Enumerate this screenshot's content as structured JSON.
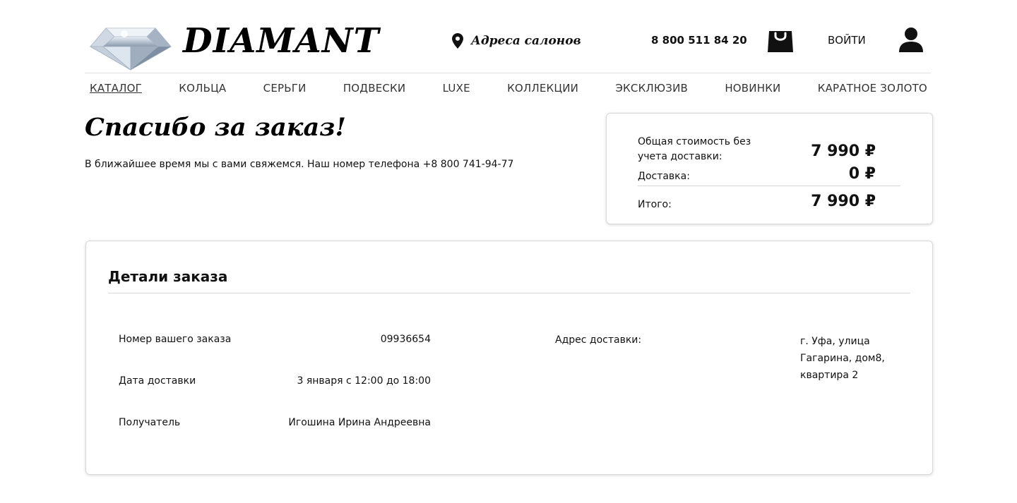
{
  "header": {
    "brand": "DIAMANT",
    "addresses_label": "Адреса салонов",
    "phone": "8 800 511 84 20",
    "login_label": "ВОЙТИ"
  },
  "nav": {
    "items": [
      {
        "label": "КАТАЛОГ",
        "active": true
      },
      {
        "label": "КОЛЬЦА"
      },
      {
        "label": "СЕРЬГИ"
      },
      {
        "label": "ПОДВЕСКИ"
      },
      {
        "label": "LUXE"
      },
      {
        "label": "КОЛЛЕКЦИИ"
      },
      {
        "label": "ЭКСКЛЮЗИВ"
      },
      {
        "label": "НОВИНКИ"
      },
      {
        "label": "КАРАТНОЕ ЗОЛОТО"
      }
    ]
  },
  "thanks": {
    "title": "Спасибо за заказ!",
    "subtitle": "В ближайшее время мы с вами свяжемся. Наш номер телефона +8 800 741-94-77"
  },
  "summary": {
    "subtotal_label": "Общая стоимость без учета доставки:",
    "subtotal_value": "7 990 ₽",
    "delivery_label": "Доставка:",
    "delivery_value": "0 ₽",
    "total_label": "Итого:",
    "total_value": "7 990 ₽"
  },
  "details": {
    "title": "Детали заказа",
    "order_number_label": "Номер вашего заказа",
    "order_number_value": "09936654",
    "delivery_date_label": "Дата доставки",
    "delivery_date_value": "3 января с 12:00 до 18:00",
    "recipient_label": "Получатель",
    "recipient_value": "Игошина Ирина Андреевна",
    "address_label": "Адрес доставки:",
    "address_value": "г. Уфа, улица Гагарина, дом8, квартира 2"
  },
  "icons": {
    "logo": "diamond-gem-icon",
    "addresses": "map-pin-icon",
    "cart": "shopping-bag-icon",
    "account": "user-icon"
  }
}
